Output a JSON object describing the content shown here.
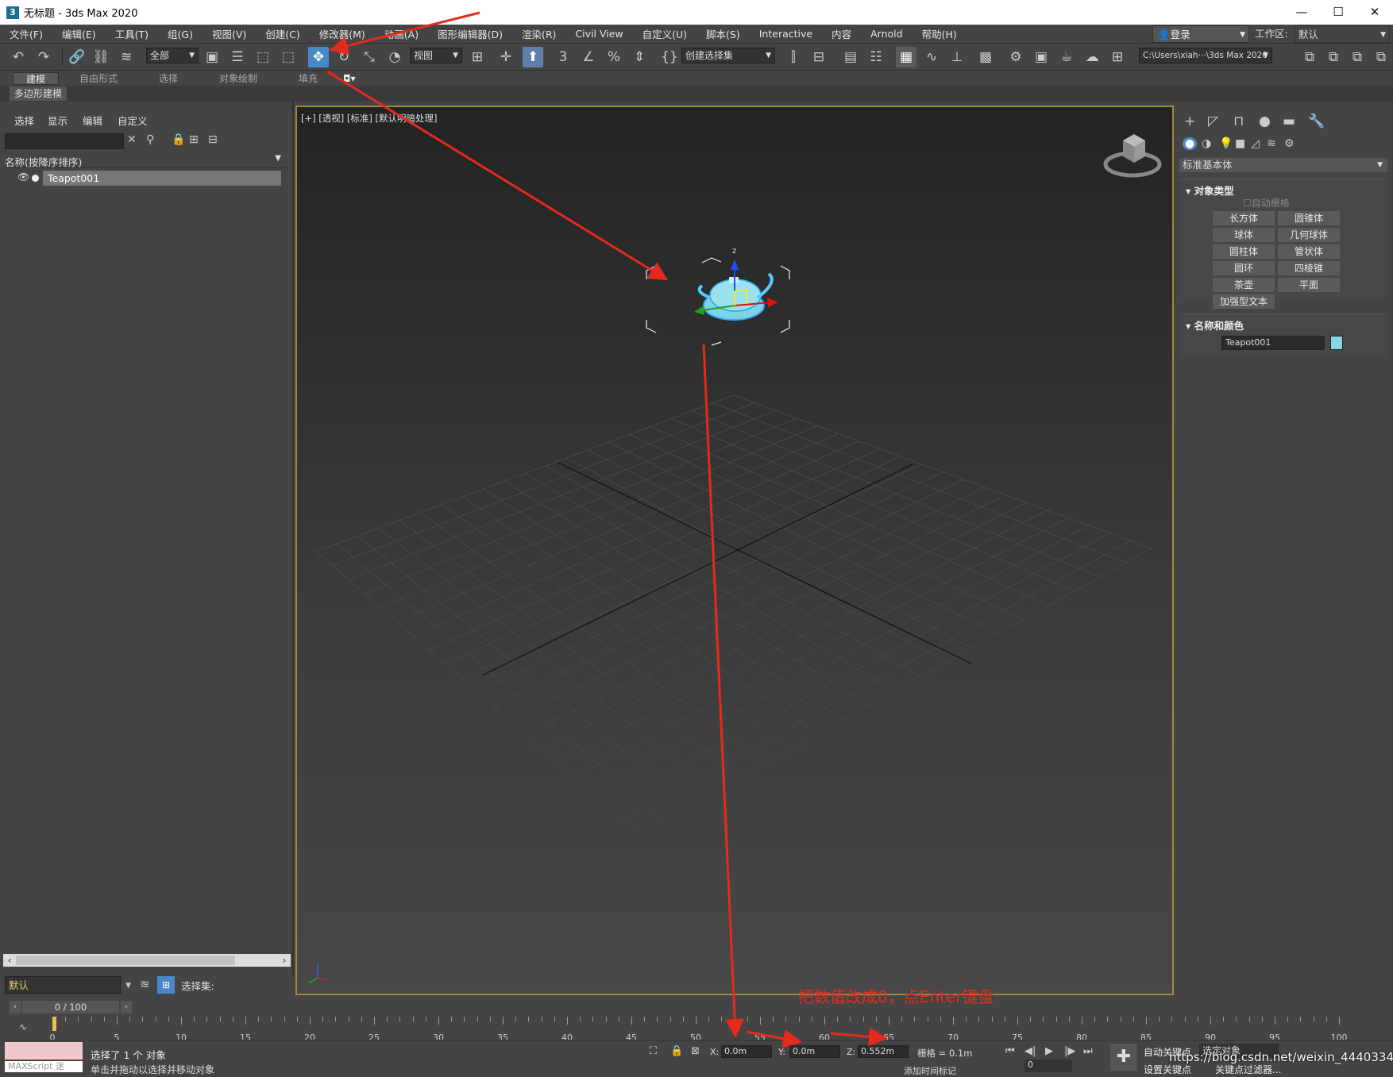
{
  "window": {
    "title": "无标题 - 3ds Max 2020",
    "app_icon": "3",
    "controls": [
      "—",
      "☐",
      "✕"
    ]
  },
  "menubar": {
    "items": [
      "文件(F)",
      "编辑(E)",
      "工具(T)",
      "组(G)",
      "视图(V)",
      "创建(C)",
      "修改器(M)",
      "动画(A)",
      "图形编辑器(D)",
      "渲染(R)",
      "Civil View",
      "自定义(U)",
      "脚本(S)",
      "Interactive",
      "内容",
      "Arnold",
      "帮助(H)"
    ],
    "login": "登录",
    "workspace_label": "工作区:",
    "workspace_value": "默认"
  },
  "toolbar": {
    "selection_filter": "全部",
    "ref_coord": "视图",
    "named_selection": "创建选择集",
    "project_path": "C:\\Users\\xiah···\\3ds Max 2020"
  },
  "ribbon": {
    "tabs": [
      "建模",
      "自由形式",
      "选择",
      "对象绘制",
      "填充"
    ],
    "active_tab": "建模",
    "sub_item": "多边形建模"
  },
  "scene_explorer": {
    "menus": [
      "选择",
      "显示",
      "编辑",
      "自定义"
    ],
    "column_header": "名称(按降序排序)",
    "objects": [
      "Teapot001"
    ]
  },
  "layer": {
    "current": "默认",
    "selection_set_label": "选择集:"
  },
  "viewport": {
    "label": "[+] [透视] [标准] [默认明暗处理]"
  },
  "command_panel": {
    "category": "标准基本体",
    "object_type_header": "对象类型",
    "autogrid": "自动栅格",
    "buttons": [
      "长方体",
      "圆锥体",
      "球体",
      "几何球体",
      "圆柱体",
      "管状体",
      "圆环",
      "四棱锥",
      "茶壶",
      "平面",
      "加强型文本"
    ],
    "name_color_header": "名称和颜色",
    "object_name": "Teapot001",
    "object_color": "#86d5e8"
  },
  "timeline": {
    "frame_counter": "0 / 100",
    "ticks": [
      "0",
      "5",
      "10",
      "15",
      "20",
      "25",
      "30",
      "35",
      "40",
      "45",
      "50",
      "55",
      "60",
      "65",
      "70",
      "75",
      "80",
      "85",
      "90",
      "95",
      "100"
    ]
  },
  "status": {
    "maxscript": "MAXScript 迷",
    "selected": "选择了 1 个 对象",
    "hint": "单击并拖动以选择并移动对象",
    "x_label": "X:",
    "x_value": "0.0m",
    "y_label": "Y:",
    "y_value": "0.0m",
    "z_label": "Z:",
    "z_value": "0.552m",
    "grid": "栅格 = 0.1m",
    "add_time_tag": "添加时间标记",
    "auto_key": "自动关键点",
    "selected_object": "选定对象",
    "set_key": "设置关键点",
    "key_filters": "关键点过滤器...",
    "frame_field": "0"
  },
  "annotation": "把数值改成0，点Enter键盘",
  "watermark": "https://blog.csdn.net/weixin_44403341"
}
